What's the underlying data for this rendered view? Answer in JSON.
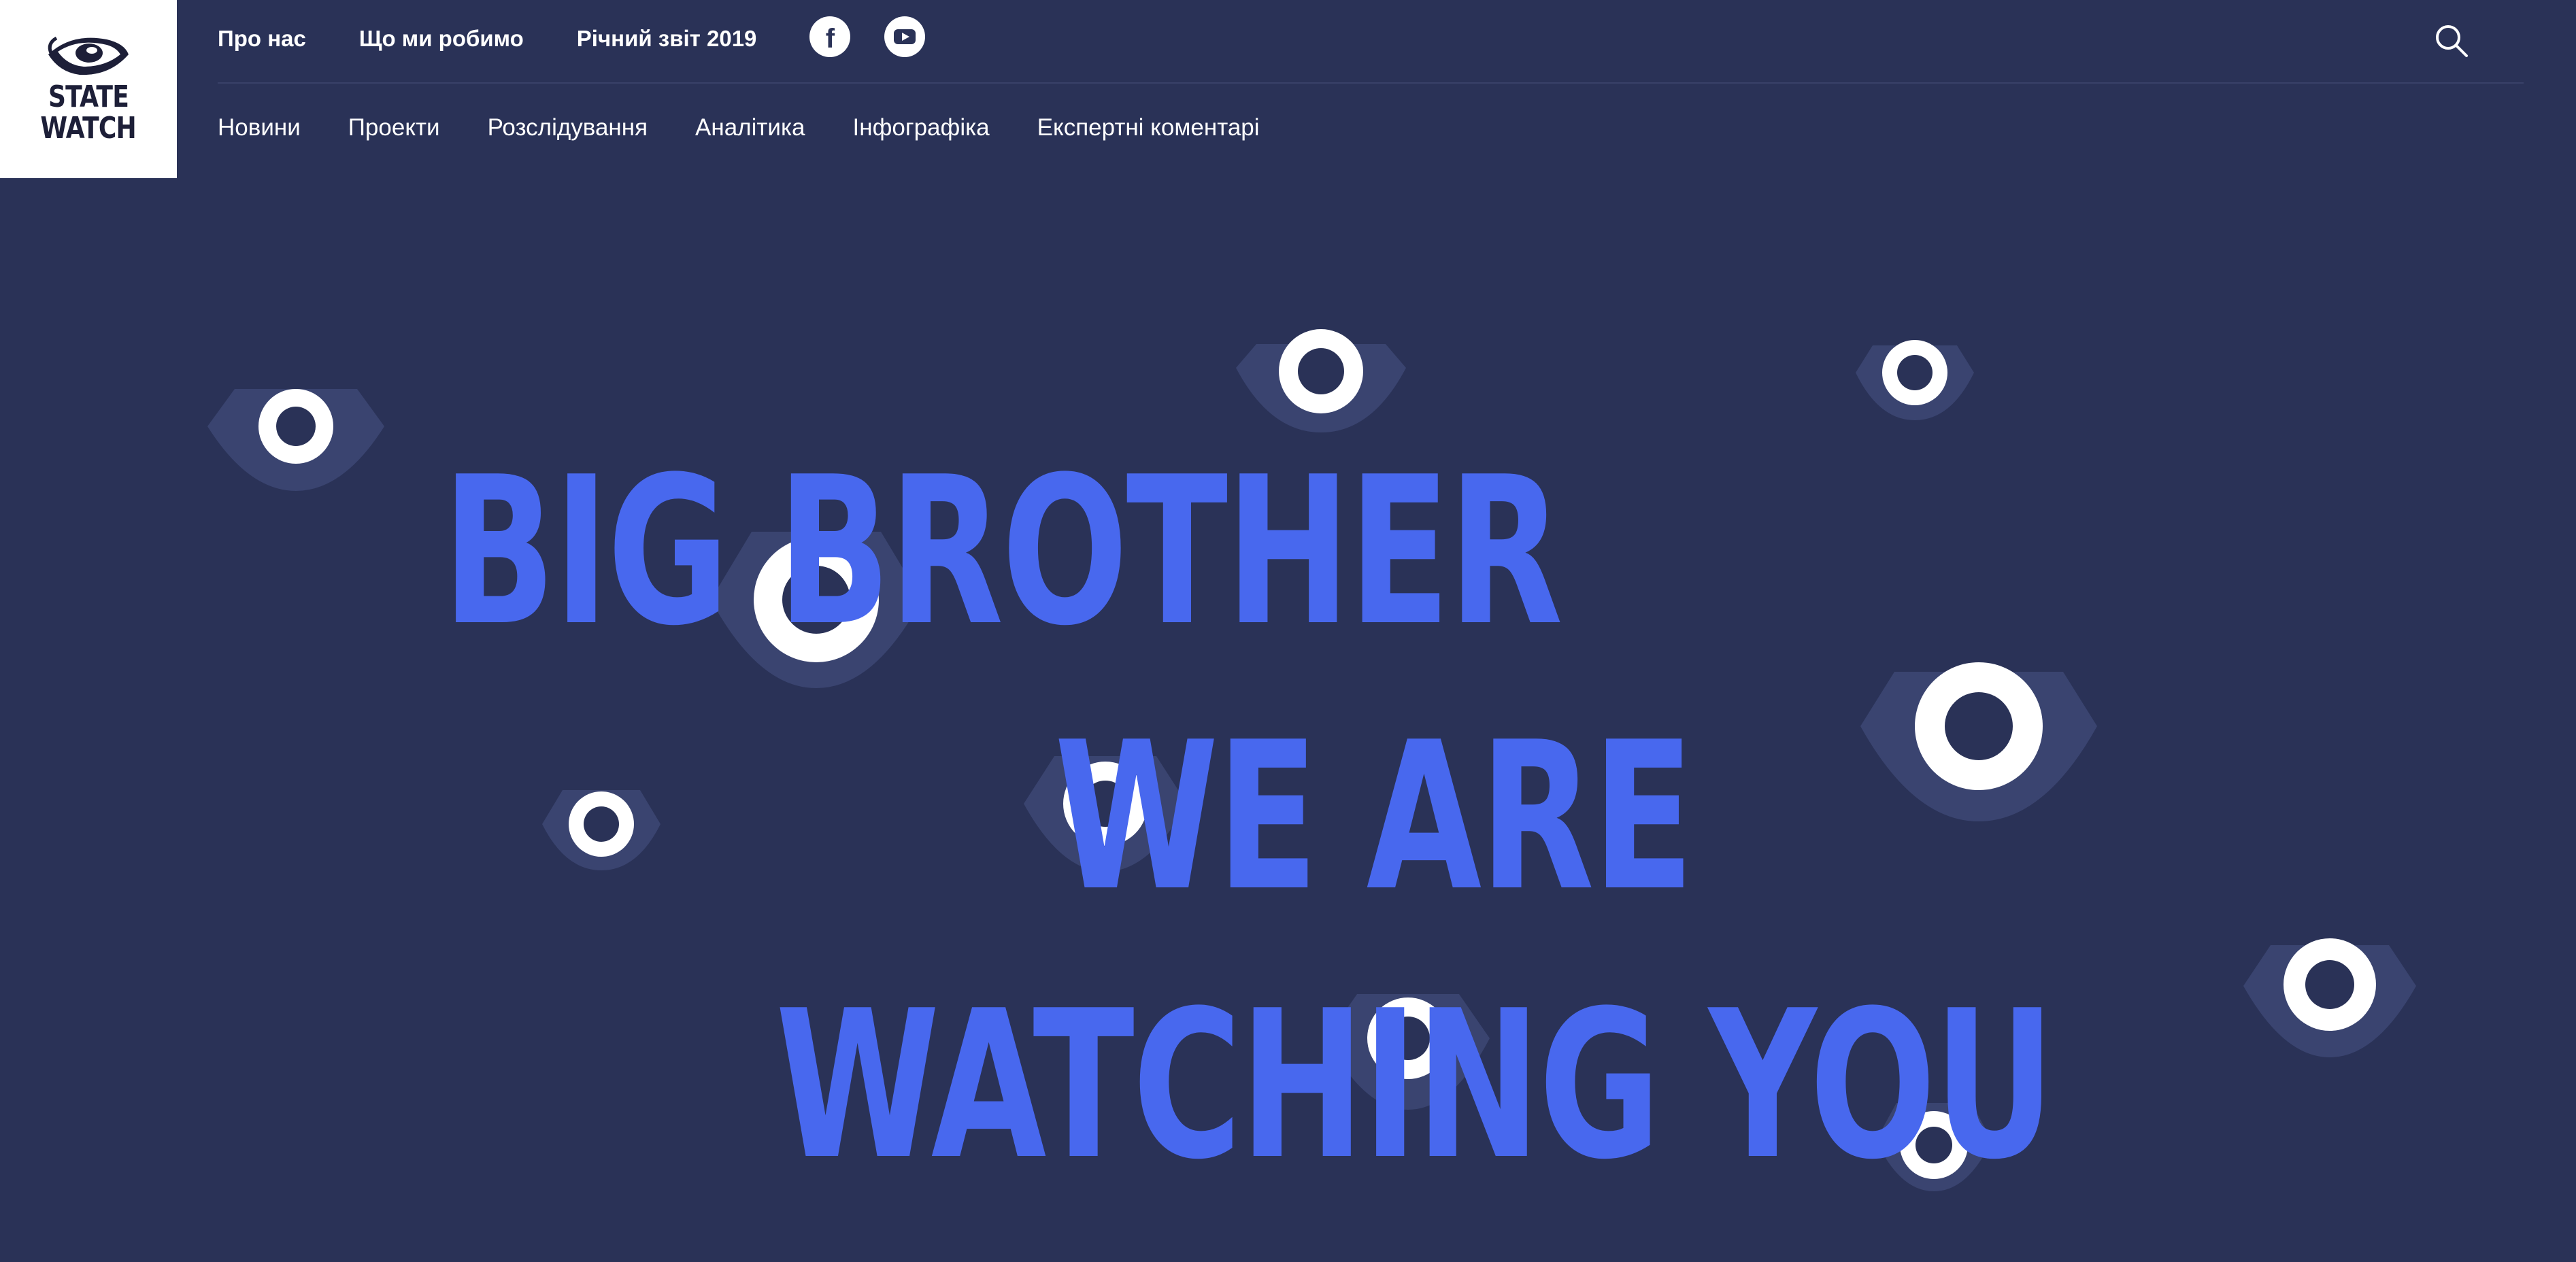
{
  "logo": {
    "line1": "STATE",
    "line2": "WATCH",
    "icon": "eye-logo-icon",
    "colors": {
      "background": "#ffffff",
      "ink": "#1d1f38"
    }
  },
  "top_nav": {
    "links": [
      {
        "label": "Про нас"
      },
      {
        "label": "Що ми робимо"
      },
      {
        "label": "Річний звіт 2019"
      }
    ],
    "social": [
      {
        "icon": "facebook-icon",
        "glyph": "f"
      },
      {
        "icon": "youtube-icon"
      }
    ],
    "search_icon": "search-icon"
  },
  "sub_nav": {
    "links": [
      {
        "label": "Новини"
      },
      {
        "label": "Проекти"
      },
      {
        "label": "Розслідування"
      },
      {
        "label": "Аналітика"
      },
      {
        "label": "Інфографіка"
      },
      {
        "label": "Експертні коментарі"
      }
    ]
  },
  "hero": {
    "lines": [
      "BIG BROTHER",
      "WE ARE",
      "WATCHING YOU"
    ],
    "decoration": "eye-icon"
  },
  "colors": {
    "background": "#2a3257",
    "headline": "#4868ee",
    "eye_shadow": "#3a4470",
    "eye_ring": "#ffffff",
    "text": "#ffffff"
  }
}
